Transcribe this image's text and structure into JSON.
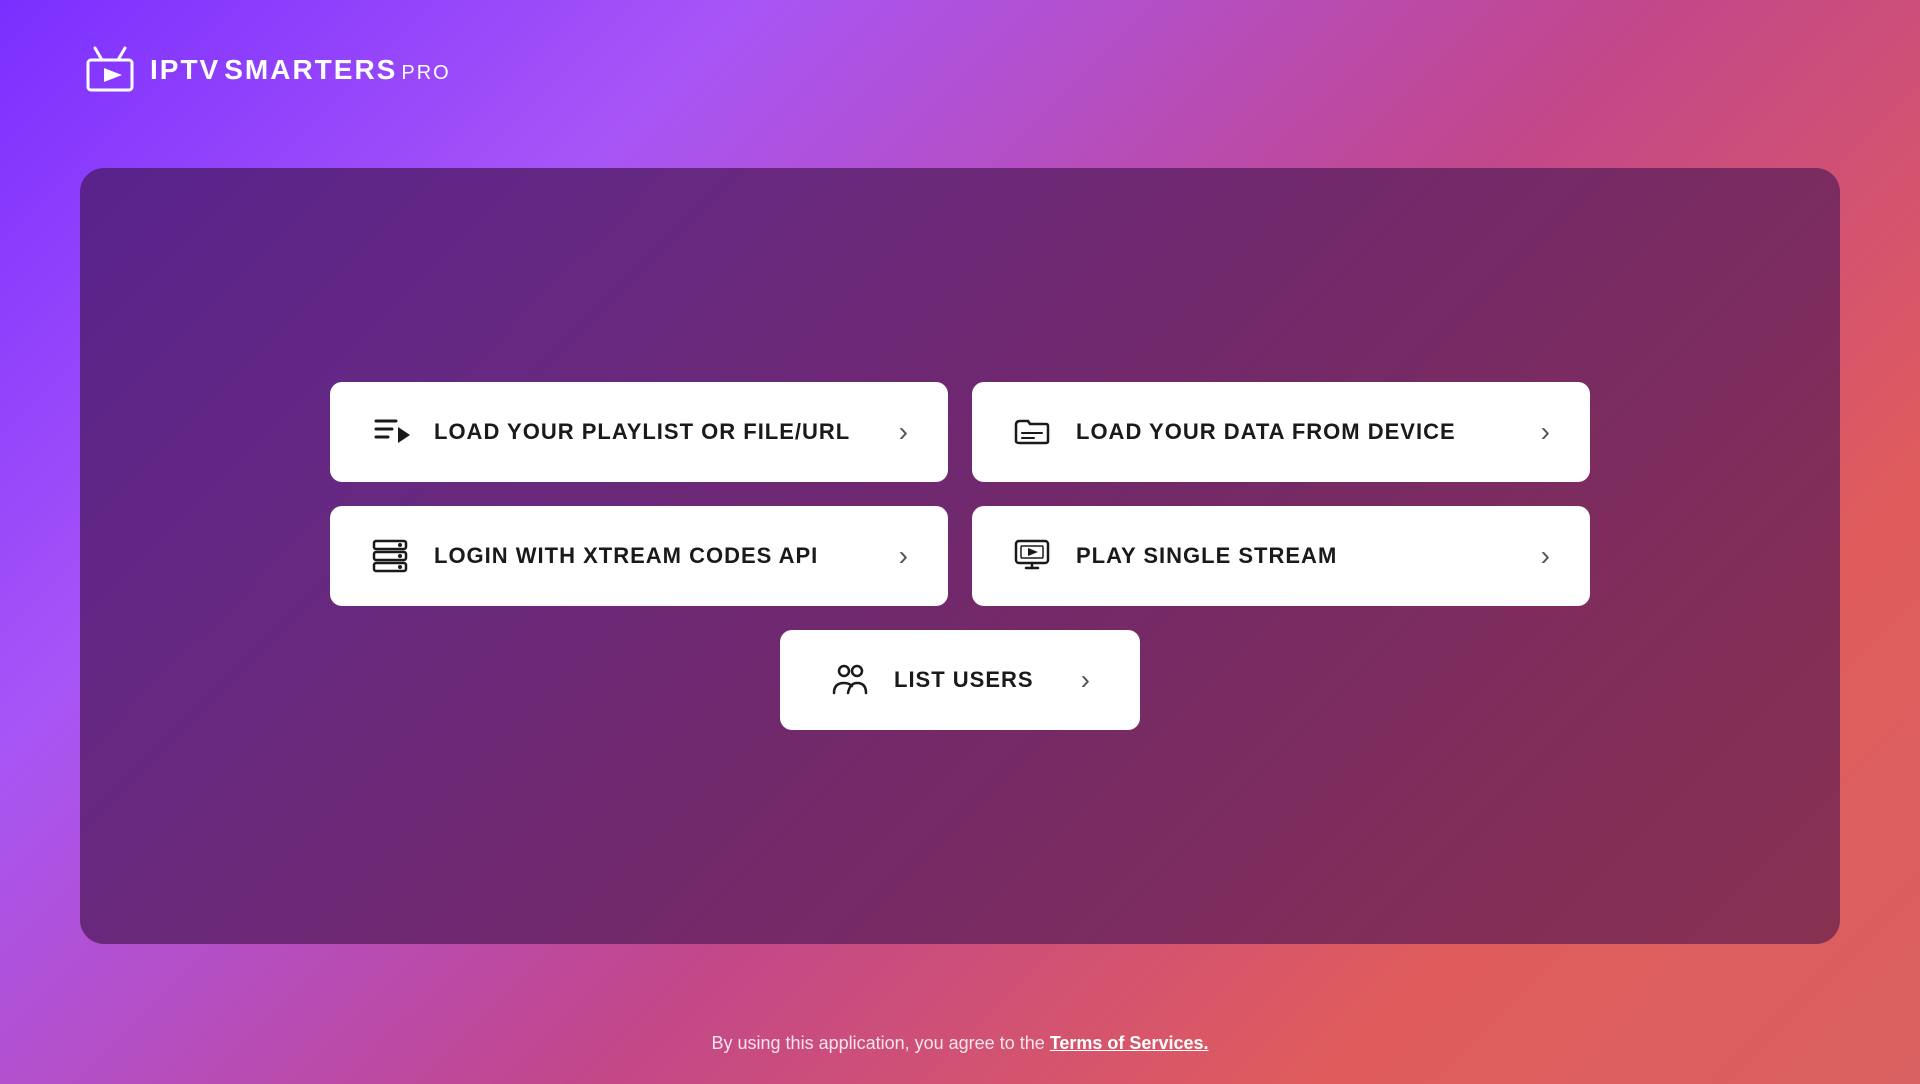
{
  "logo": {
    "iptv": "IPTV",
    "smarters": "SMARTERS",
    "pro": "PRO"
  },
  "buttons": [
    {
      "id": "playlist",
      "label": "LOAD YOUR PLAYLIST OR FILE/URL",
      "icon": "playlist-icon"
    },
    {
      "id": "device",
      "label": "LOAD YOUR DATA FROM DEVICE",
      "icon": "device-icon"
    },
    {
      "id": "xtream",
      "label": "LOGIN WITH XTREAM CODES API",
      "icon": "xtream-icon"
    },
    {
      "id": "single-stream",
      "label": "PLAY SINGLE STREAM",
      "icon": "stream-icon"
    }
  ],
  "center_button": {
    "id": "list-users",
    "label": "LIST USERS",
    "icon": "users-icon"
  },
  "footer": {
    "text": "By using this application, you agree to the ",
    "link_text": "Terms of Services."
  }
}
